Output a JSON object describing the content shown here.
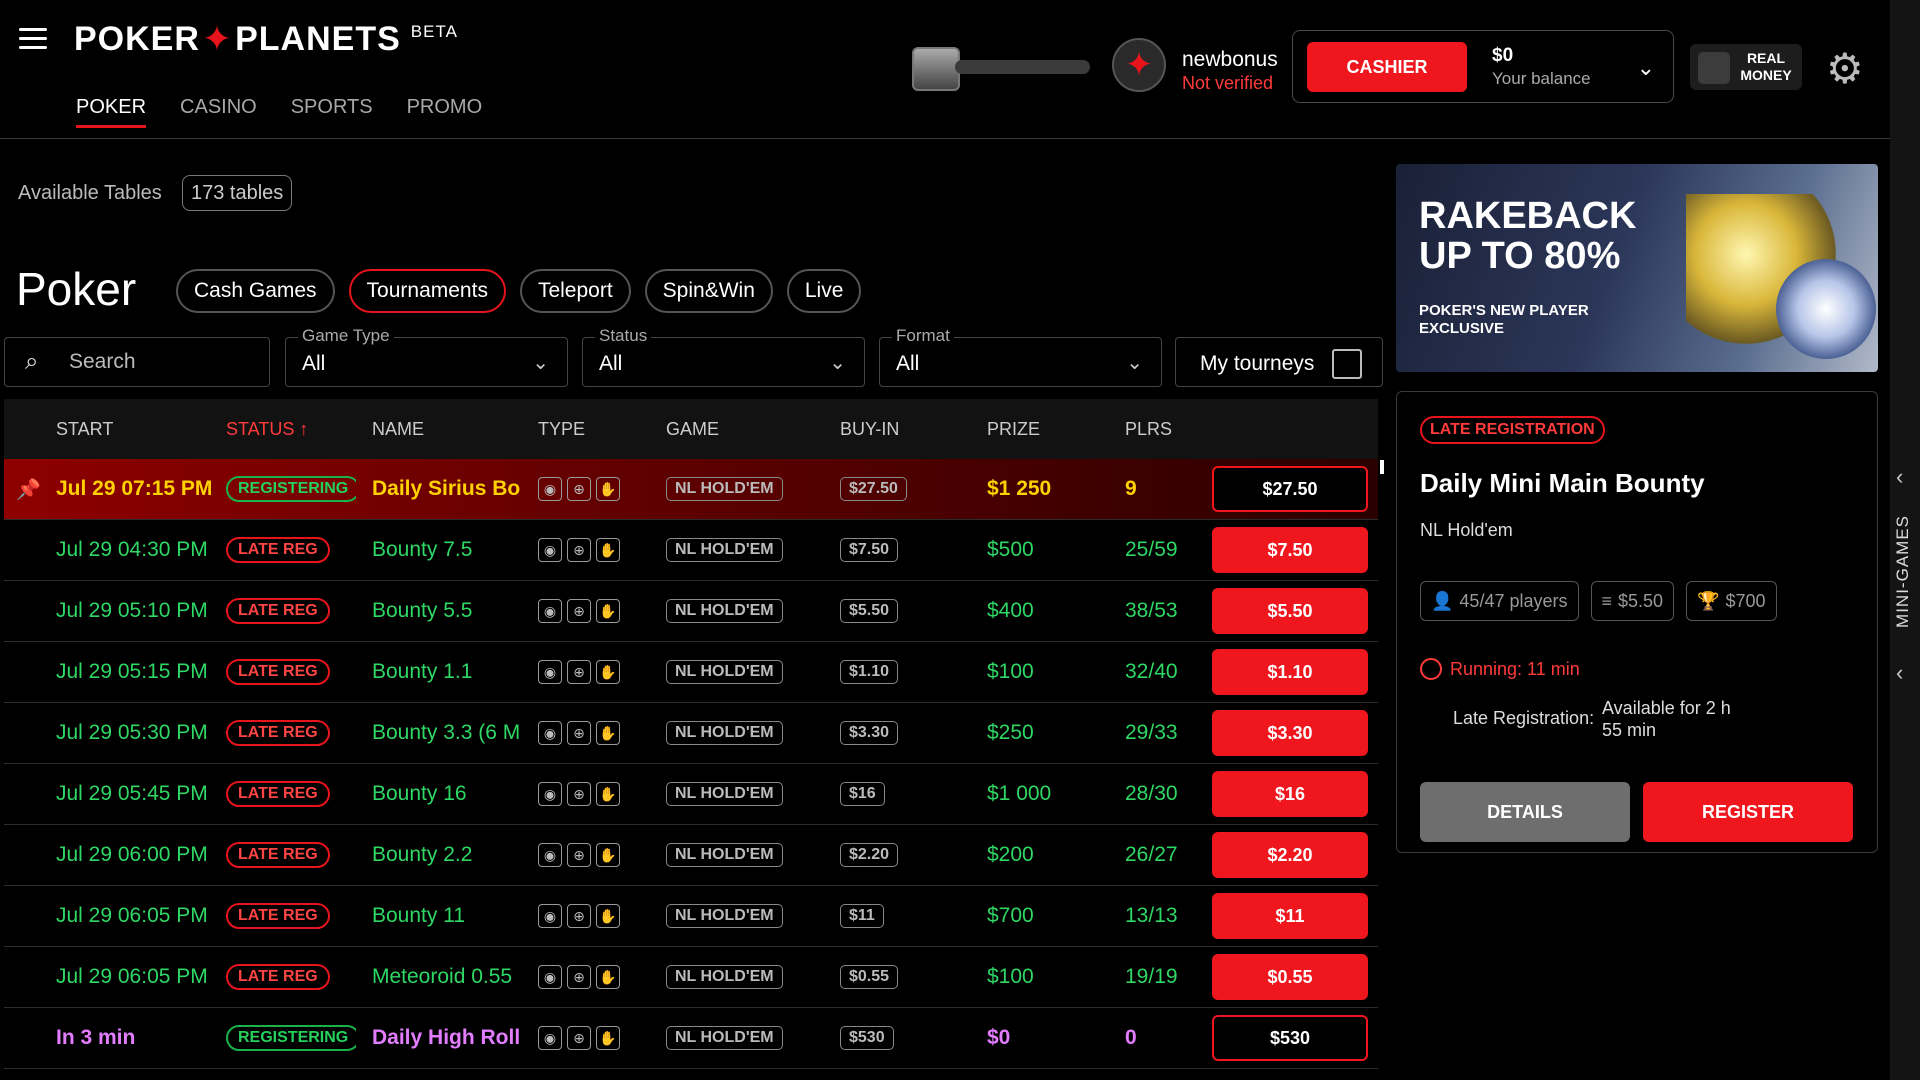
{
  "header": {
    "logo_left": "POKER",
    "logo_right": "PLANETS",
    "logo_beta": "BETA",
    "nav": [
      {
        "label": "POKER",
        "active": true
      },
      {
        "label": "CASINO",
        "active": false
      },
      {
        "label": "SPORTS",
        "active": false
      },
      {
        "label": "PROMO",
        "active": false
      }
    ],
    "user_name": "newbonus",
    "user_status": "Not verified",
    "cashier_label": "CASHIER",
    "balance": "$0",
    "balance_label": "Your balance",
    "real_money_label_1": "REAL",
    "real_money_label_2": "MONEY"
  },
  "side_rail": {
    "label": "MINI-GAMES"
  },
  "lobby": {
    "available_label": "Available Tables",
    "available_count": "173 tables",
    "title": "Poker",
    "tabs": [
      {
        "label": "Cash Games",
        "active": false
      },
      {
        "label": "Tournaments",
        "active": true
      },
      {
        "label": "Teleport",
        "active": false
      },
      {
        "label": "Spin&Win",
        "active": false
      },
      {
        "label": "Live",
        "active": false
      }
    ],
    "search_placeholder": "Search",
    "filters": {
      "game_type_label": "Game Type",
      "game_type_value": "All",
      "status_label": "Status",
      "status_value": "All",
      "format_label": "Format",
      "format_value": "All",
      "my_tourneys_label": "My tourneys"
    }
  },
  "table": {
    "columns": [
      "START",
      "STATUS ↑",
      "NAME",
      "TYPE",
      "GAME",
      "BUY-IN",
      "PRIZE",
      "PLRS"
    ],
    "rows": [
      {
        "start": "Jul 29 07:15 PM",
        "status": "REGISTERING",
        "name": "Daily Sirius Bou",
        "game": "NL HOLD'EM",
        "buyin": "$27.50",
        "prize": "$1 250",
        "plrs": "9",
        "action": "$27.50",
        "style": "highlight"
      },
      {
        "start": "Jul 29 04:30 PM",
        "status": "LATE REG",
        "name": "Bounty 7.5",
        "game": "NL HOLD'EM",
        "buyin": "$7.50",
        "prize": "$500",
        "plrs": "25/59",
        "action": "$7.50",
        "style": "late"
      },
      {
        "start": "Jul 29 05:10 PM",
        "status": "LATE REG",
        "name": "Bounty 5.5",
        "game": "NL HOLD'EM",
        "buyin": "$5.50",
        "prize": "$400",
        "plrs": "38/53",
        "action": "$5.50",
        "style": "late"
      },
      {
        "start": "Jul 29 05:15 PM",
        "status": "LATE REG",
        "name": "Bounty 1.1",
        "game": "NL HOLD'EM",
        "buyin": "$1.10",
        "prize": "$100",
        "plrs": "32/40",
        "action": "$1.10",
        "style": "late"
      },
      {
        "start": "Jul 29 05:30 PM",
        "status": "LATE REG",
        "name": "Bounty 3.3 (6 M",
        "game": "NL HOLD'EM",
        "buyin": "$3.30",
        "prize": "$250",
        "plrs": "29/33",
        "action": "$3.30",
        "style": "late"
      },
      {
        "start": "Jul 29 05:45 PM",
        "status": "LATE REG",
        "name": "Bounty 16",
        "game": "NL HOLD'EM",
        "buyin": "$16",
        "prize": "$1 000",
        "plrs": "28/30",
        "action": "$16",
        "style": "late"
      },
      {
        "start": "Jul 29 06:00 PM",
        "status": "LATE REG",
        "name": "Bounty 2.2",
        "game": "NL HOLD'EM",
        "buyin": "$2.20",
        "prize": "$200",
        "plrs": "26/27",
        "action": "$2.20",
        "style": "late"
      },
      {
        "start": "Jul 29 06:05 PM",
        "status": "LATE REG",
        "name": "Bounty 11",
        "game": "NL HOLD'EM",
        "buyin": "$11",
        "prize": "$700",
        "plrs": "13/13",
        "action": "$11",
        "style": "late"
      },
      {
        "start": "Jul 29 06:05 PM",
        "status": "LATE REG",
        "name": "Meteoroid 0.55",
        "game": "NL HOLD'EM",
        "buyin": "$0.55",
        "prize": "$100",
        "plrs": "19/19",
        "action": "$0.55",
        "style": "late"
      },
      {
        "start": "In 3 min",
        "status": "REGISTERING",
        "name": "Daily High Roll",
        "game": "NL HOLD'EM",
        "buyin": "$530",
        "prize": "$0",
        "plrs": "0",
        "action": "$530",
        "style": "soon"
      }
    ]
  },
  "banner": {
    "headline_1": "RAKEBACK",
    "headline_2": "UP TO 80%",
    "sub_1": "POKER'S NEW PLAYER",
    "sub_2": "EXCLUSIVE"
  },
  "detail": {
    "badge": "LATE REGISTRATION",
    "title": "Daily Mini Main Bounty",
    "game": "NL Hold'em",
    "players": "45/47 players",
    "buyin": "$5.50",
    "prize": "$700",
    "running": "Running: 11 min",
    "late_reg_label": "Late Registration:",
    "late_reg_value": "Available for 2 h 55 min",
    "details_button": "DETAILS",
    "register_button": "REGISTER"
  },
  "colors": {
    "accent": "#f0161d",
    "green": "#2fd765",
    "yellow": "#ffd200",
    "pink": "#e27dff"
  }
}
